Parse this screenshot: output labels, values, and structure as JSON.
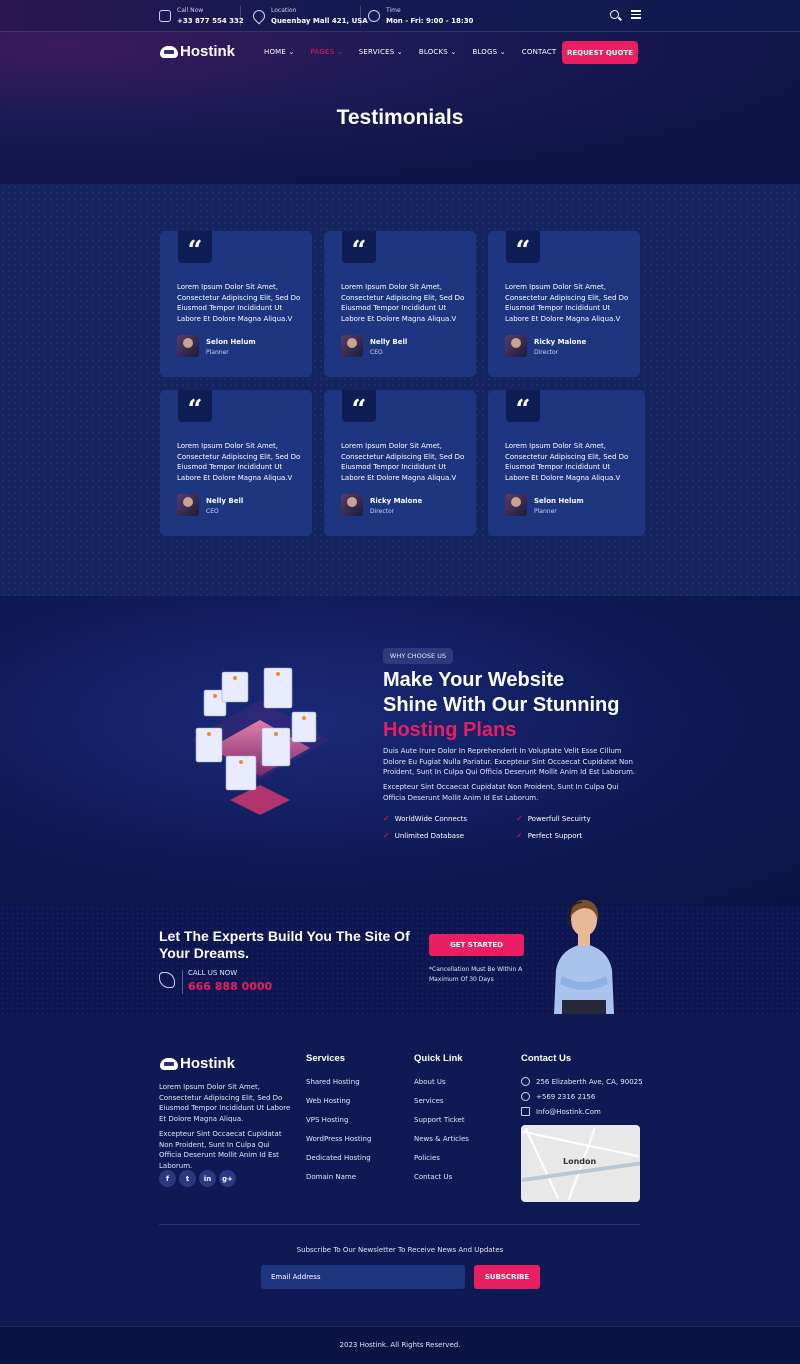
{
  "topbar": {
    "call_label": "Call Now",
    "call_value": "+33 877 554 332",
    "location_label": "Location",
    "location_value": "Queenbay Mall 421, USA",
    "time_label": "Time",
    "time_value": "Mon - Fri: 9:00 - 18:30",
    "icons": [
      "phone-icon",
      "location-icon",
      "clock-icon",
      "search-icon",
      "menu-icon"
    ]
  },
  "header": {
    "logo_text": "Hostink",
    "nav": [
      "HOME",
      "PAGES",
      "SERVICES",
      "BLOCKS",
      "BLOGS",
      "CONTACT"
    ],
    "active_nav": "PAGES",
    "cta": "REQUEST QUOTE",
    "page_title": "Testimonials"
  },
  "testimonials": [
    {
      "quote": "Lorem Ipsum Dolor Sit Amet, Consectetur Adipiscing Elit, Sed Do Eiusmod Tempor Incididunt Ut Labore Et Dolore Magna Aliqua.V",
      "name": "Selon Helum",
      "role": "Planner"
    },
    {
      "quote": "Lorem Ipsum Dolor Sit Amet, Consectetur Adipiscing Elit, Sed Do Eiusmod Tempor Incididunt Ut Labore Et Dolore Magna Aliqua.V",
      "name": "Nelly Bell",
      "role": "CEO"
    },
    {
      "quote": "Lorem Ipsum Dolor Sit Amet, Consectetur Adipiscing Elit, Sed Do Eiusmod Tempor Incididunt Ut Labore Et Dolore Magna Aliqua.V",
      "name": "Ricky Malone",
      "role": "Director"
    },
    {
      "quote": "Lorem Ipsum Dolor Sit Amet, Consectetur Adipiscing Elit, Sed Do Eiusmod Tempor Incididunt Ut Labore Et Dolore Magna Aliqua.V",
      "name": "Nelly Bell",
      "role": "CEO"
    },
    {
      "quote": "Lorem Ipsum Dolor Sit Amet, Consectetur Adipiscing Elit, Sed Do Eiusmod Tempor Incididunt Ut Labore Et Dolore Magna Aliqua.V",
      "name": "Ricky Malone",
      "role": "Director"
    },
    {
      "quote": "Lorem Ipsum Dolor Sit Amet, Consectetur Adipiscing Elit, Sed Do Eiusmod Tempor Incididunt Ut Labore Et Dolore Magna Aliqua.V",
      "name": "Selon Helum",
      "role": "Planner"
    }
  ],
  "why": {
    "badge": "WHY CHOOSE US",
    "title_line1": "Make Your Website",
    "title_line2": "Shine With Our Stunning",
    "title_highlight": "Hosting Plans",
    "para1": "Duis Aute Irure Dolor In Reprehenderit In Voluptate Velit Esse Cillum Dolore Eu Fugiat Nulla Pariatur. Excepteur Sint Occaecat Cupidatat Non Proident, Sunt In Culpa Qui Officia Deserunt Mollit Anim Id Est Laborum.",
    "para2": "Excepteur Sint Occaecat Cupidatat Non Proident, Sunt In Culpa Qui Officia Deserunt Mollit Anim Id Est Laborum.",
    "features": [
      "WorldWide Connects",
      "Powerfull Secuirty",
      "Unlimited Database",
      "Perfect Support"
    ]
  },
  "cta": {
    "title": "Let The Experts Build You The Site Of Your Dreams.",
    "call_label": "CALL US NOW",
    "call_number": "666 888 0000",
    "button": "GET STARTED",
    "note": "*Cancellation Must Be Within A Maximum Of 30 Days"
  },
  "footer": {
    "logo_text": "Hostink",
    "about1": "Lorem Ipsum Dolor Sit Amet, Consectetur Adipiscing Elit, Sed Do Eiusmod Tempor Incididunt Ut Labore Et Dolore Magna Aliqua.",
    "about2": "Excepteur Sint Occaecat Cupidatat Non Proident, Sunt In Culpa Qui Officia Deserunt Mollit Anim Id Est Laborum.",
    "social": [
      "f",
      "t",
      "in",
      "g+"
    ],
    "services_title": "Services",
    "services": [
      "Shared Hosting",
      "Web Hosting",
      "VPS Hosting",
      "WordPress Hosting",
      "Dedicated Hosting",
      "Domain Name"
    ],
    "quick_title": "Quick Link",
    "quick": [
      "About Us",
      "Services",
      "Support Ticket",
      "News & Articles",
      "Policies",
      "Contact Us"
    ],
    "contact_title": "Contact Us",
    "address": "256 Elizaberth Ave, CA, 90025",
    "phone": "+569 2316 2156",
    "email": "Info@Hostink.Com",
    "map_label": "London",
    "newsletter_text": "Subscribe To Our Newsletter To Receive News And Updates",
    "email_placeholder": "Email Address",
    "subscribe": "SUBSCRIBE",
    "copyright": "2023 Hostink. All Rights Reserved."
  },
  "colors": {
    "accent": "#e91e63",
    "bg": "#0c1445",
    "card": "#1e3580"
  }
}
